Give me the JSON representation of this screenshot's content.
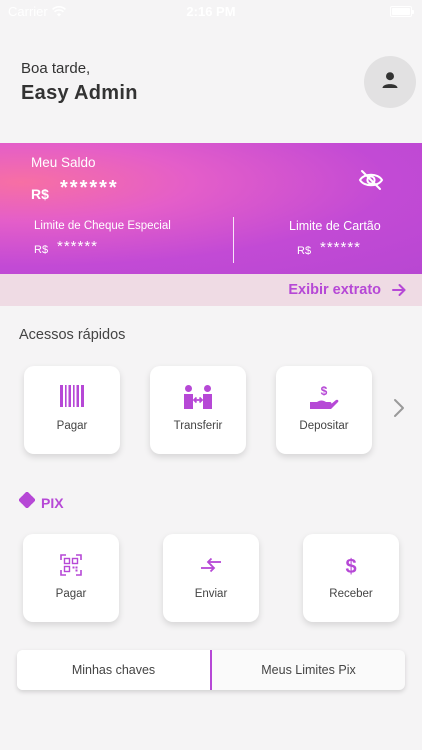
{
  "status_bar": {
    "carrier": "Carrier",
    "time": "2:16 PM"
  },
  "header": {
    "greeting": "Boa tarde,",
    "user_name": "Easy Admin",
    "avatar_icon": "user-icon"
  },
  "balance": {
    "label": "Meu Saldo",
    "currency": "R$",
    "masked_value": "******",
    "visibility_icon": "eye-off-icon",
    "cheque_label": "Limite de Cheque Especial",
    "cheque_currency": "R$",
    "cheque_masked": "******",
    "card_label": "Limite de Cartão",
    "card_currency": "R$",
    "card_masked": "******"
  },
  "extrato": {
    "label": "Exibir extrato",
    "icon": "arrow-right-icon"
  },
  "quick_access": {
    "title": "Acessos rápidos",
    "items": [
      {
        "label": "Pagar",
        "icon": "barcode-icon"
      },
      {
        "label": "Transferir",
        "icon": "transfer-people-icon"
      },
      {
        "label": "Depositar",
        "icon": "deposit-hand-icon"
      }
    ],
    "next_icon": "chevron-right-icon"
  },
  "pix": {
    "title": "PIX",
    "icon": "pix-icon",
    "items": [
      {
        "label": "Pagar",
        "icon": "qr-code-icon"
      },
      {
        "label": "Enviar",
        "icon": "swap-arrows-icon"
      },
      {
        "label": "Receber",
        "icon": "dollar-icon"
      }
    ],
    "tabs": [
      {
        "label": "Minhas chaves"
      },
      {
        "label": "Meus Limites Pix"
      }
    ]
  },
  "colors": {
    "accent": "#b648d6",
    "gradient_start": "#f76fa4",
    "gradient_end": "#b847d2",
    "extrato_bg": "#efdbe4"
  }
}
